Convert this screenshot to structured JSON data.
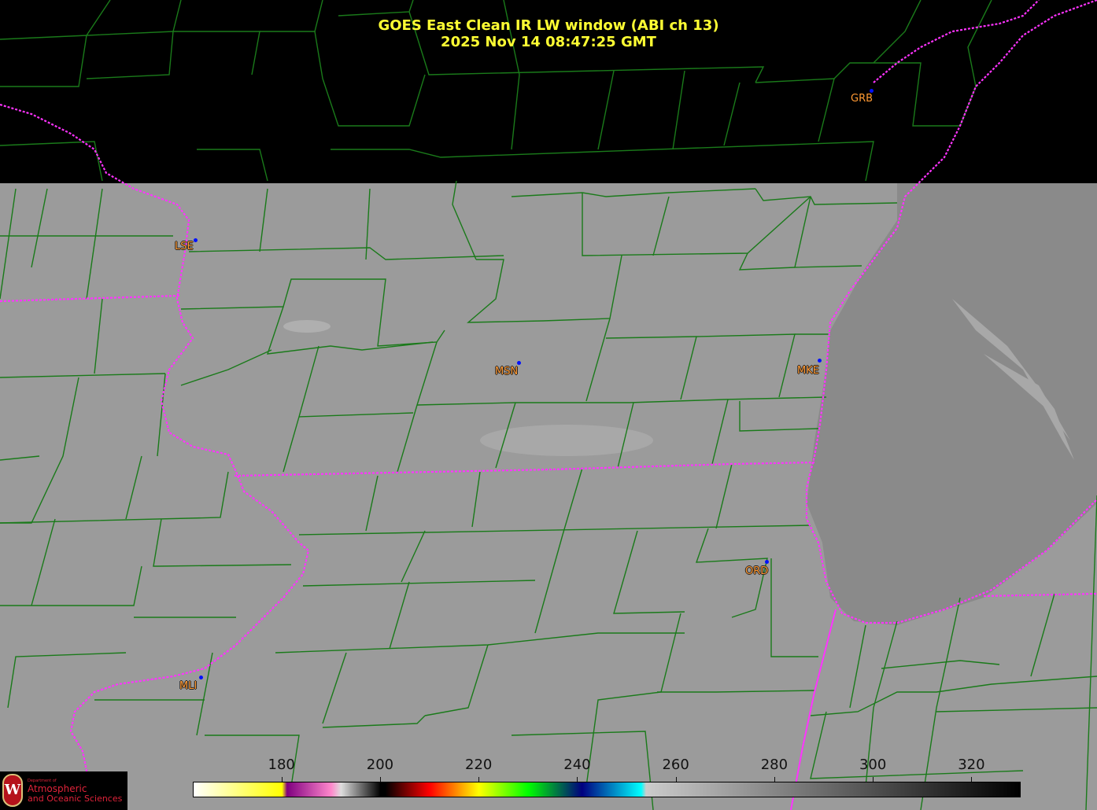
{
  "title": {
    "line1": "GOES East Clean IR LW window (ABI ch 13)",
    "line2": "2025 Nov 14  08:47:25 GMT"
  },
  "stations": [
    {
      "id": "GRB"
    },
    {
      "id": "LSE"
    },
    {
      "id": "MSN"
    },
    {
      "id": "MKE"
    },
    {
      "id": "ORD"
    },
    {
      "id": "MLI"
    }
  ],
  "colorbar": {
    "unit_range": [
      162,
      330
    ],
    "ticks": [
      "180",
      "200",
      "220",
      "240",
      "260",
      "280",
      "300",
      "320"
    ],
    "stops": [
      {
        "value": 162,
        "color": "#ffffff"
      },
      {
        "value": 180,
        "color": "#ffff00"
      },
      {
        "value": 181,
        "color": "#800080"
      },
      {
        "value": 190,
        "color": "#ff88cc"
      },
      {
        "value": 192,
        "color": "#dddddd"
      },
      {
        "value": 200,
        "color": "#000000"
      },
      {
        "value": 201,
        "color": "#000000"
      },
      {
        "value": 210,
        "color": "#ff0000"
      },
      {
        "value": 220,
        "color": "#ffff00"
      },
      {
        "value": 230,
        "color": "#00ff00"
      },
      {
        "value": 241,
        "color": "#000080"
      },
      {
        "value": 253,
        "color": "#00ffff"
      },
      {
        "value": 254,
        "color": "#cccccc"
      },
      {
        "value": 330,
        "color": "#000000"
      }
    ]
  },
  "logo": {
    "dept": "Department of",
    "line1": "Atmospheric",
    "line2": "and Oceanic Sciences"
  },
  "colors": {
    "title": "#ffff33",
    "county": "#1a7a1a",
    "state": "#ff33ff",
    "station": "#ff9933"
  }
}
